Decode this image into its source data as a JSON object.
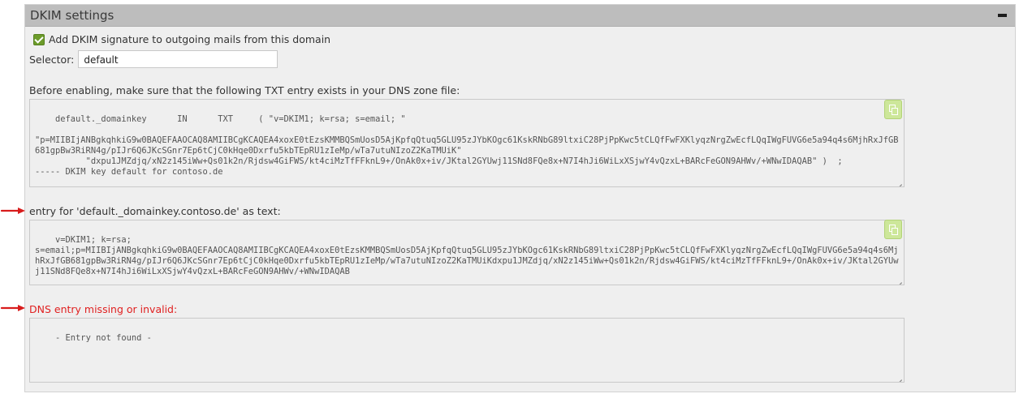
{
  "panel": {
    "title": "DKIM settings"
  },
  "checkbox": {
    "label": "Add DKIM signature to outgoing mails from this domain",
    "checked": true
  },
  "selector": {
    "label": "Selector:",
    "value": "default"
  },
  "dns_zone": {
    "label": "Before enabling, make sure that the following TXT entry exists in your DNS zone file:",
    "content": "default._domainkey      IN      TXT     ( \"v=DKIM1; k=rsa; s=email; \"\n\n\"p=MIIBIjANBgkqhkiG9w0BAQEFAAOCAQ8AMIIBCgKCAQEA4xoxE0tEzsKMMBQSmUosD5AjKpfqQtuq5GLU95zJYbKOgc61KskRNbG89ltxiC28PjPpKwc5tCLQfFwFXKlyqzNrgZwEcfLQqIWgFUVG6e5a94q4s6MjhRxJfGB681gpBw3RiRN4g/pIJr6Q6JKcSGnr7Ep6tCjC0kHqe0Dxrfu5kbTEpRU1zIeMp/wTa7utuNIzoZ2KaTMUiK\"\n          \"dxpu1JMZdjq/xN2z145iWw+Qs01k2n/Rjdsw4GiFWS/kt4ciMzTfFFknL9+/OnAk0x+iv/JKtal2GYUwj11SNd8FQe8x+N7I4hJi6WiLxXSjwY4vQzxL+BARcFeGON9AHWv/+WNwIDAQAB\" )  ;\n----- DKIM key default for contoso.de"
  },
  "text_entry": {
    "label": "entry for 'default._domainkey.contoso.de' as text:",
    "content": "v=DKIM1; k=rsa;\ns=email;p=MIIBIjANBgkqhkiG9w0BAQEFAAOCAQ8AMIIBCgKCAQEA4xoxE0tEzsKMMBQSmUosD5AjKpfqQtuq5GLU95zJYbKOgc61KskRNbG89ltxiC28PjPpKwc5tCLQfFwFXKlyqzNrgZwEcfLQqIWgFUVG6e5a94q4s6MjhRxJfGB681gpBw3RiRN4g/pIJr6Q6JKcSGnr7Ep6tCjC0kHqe0Dxrfu5kbTEpRU1zIeMp/wTa7utuNIzoZ2KaTMUiKdxpu1JMZdjq/xN2z145iWw+Qs01k2n/Rjdsw4GiFWS/kt4ciMzTfFFknL9+/OnAk0x+iv/JKtal2GYUwj11SNd8FQe8x+N7I4hJi6WiLxXSjwY4vQzxL+BARcFeGON9AHWv/+WNwIDAQAB"
  },
  "dns_status": {
    "label": "DNS entry missing or invalid:",
    "content": "- Entry not found -"
  },
  "colors": {
    "header_bg": "#bdbdbd",
    "panel_bg": "#efefef",
    "checkbox": "#6c9b2a",
    "copy_button": "#cde79a",
    "error_text": "#e02020",
    "arrow": "#d81c1c"
  }
}
